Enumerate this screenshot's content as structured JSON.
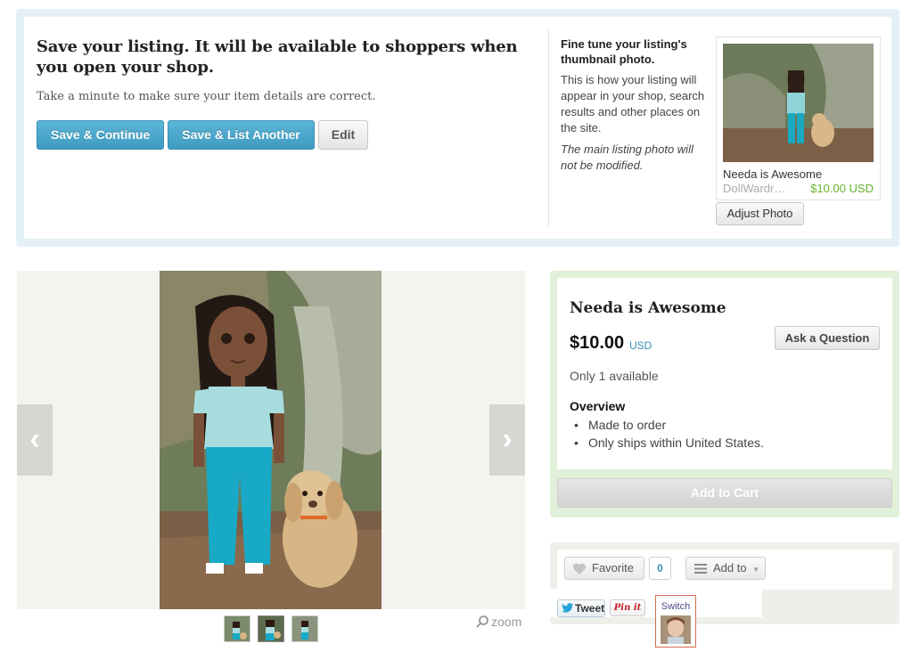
{
  "banner": {
    "title": "Save your listing. It will be available to shoppers when you open your shop.",
    "subtitle": "Take a minute to make sure your item details are correct.",
    "buttons": {
      "save_continue": "Save & Continue",
      "save_list_another": "Save & List Another",
      "edit": "Edit"
    },
    "thumbnail": {
      "heading": "Fine tune your listing's thumbnail photo.",
      "description": "This is how your listing will appear in your shop, search results and other places on the site.",
      "note": "The main listing photo will not be modified.",
      "preview_title": "Needa is Awesome",
      "preview_shop": "DollWardr…",
      "preview_price": "$10.00 USD",
      "adjust_button": "Adjust Photo"
    }
  },
  "gallery": {
    "prev_icon": "chevron-left-icon",
    "next_icon": "chevron-right-icon",
    "zoom_label": "zoom",
    "thumbnail_count": 3,
    "active_thumbnail": 2
  },
  "listing": {
    "title": "Needa is Awesome",
    "price": "$10.00",
    "currency": "USD",
    "ask_button": "Ask a Question",
    "availability": "Only 1 available",
    "overview_heading": "Overview",
    "overview_items": [
      "Made to order",
      "Only ships within United States."
    ],
    "cart_button": "Add to Cart"
  },
  "social": {
    "favorite_label": "Favorite",
    "favorite_count": "0",
    "add_to_label": "Add to",
    "tweet_label": "Tweet",
    "pin_label": "Pin it",
    "switch_label": "Switch"
  },
  "colors": {
    "accent_blue": "#3e9ac0",
    "price_green": "#66b32e",
    "banner_bg": "#e3f1f7",
    "listing_bg": "#e1f0d8"
  }
}
